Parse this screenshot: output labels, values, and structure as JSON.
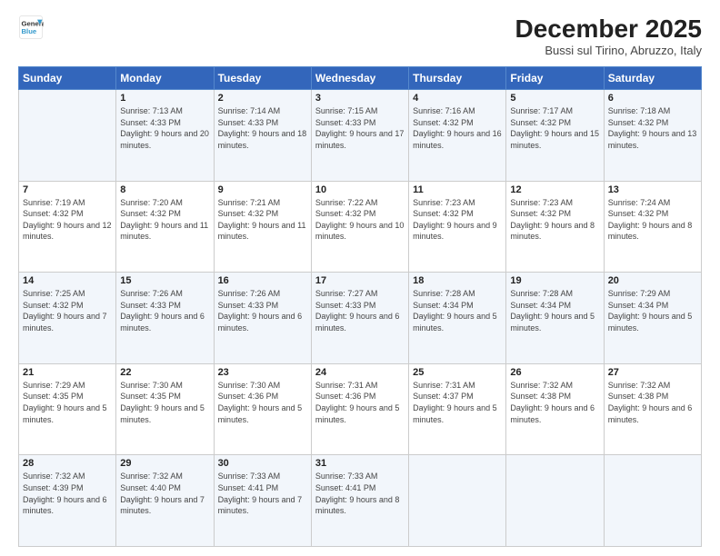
{
  "logo": {
    "line1": "General",
    "line2": "Blue"
  },
  "header": {
    "month": "December 2025",
    "location": "Bussi sul Tirino, Abruzzo, Italy"
  },
  "days_of_week": [
    "Sunday",
    "Monday",
    "Tuesday",
    "Wednesday",
    "Thursday",
    "Friday",
    "Saturday"
  ],
  "weeks": [
    [
      {
        "day": "",
        "sunrise": "",
        "sunset": "",
        "daylight": "",
        "empty": true
      },
      {
        "day": "1",
        "sunrise": "7:13 AM",
        "sunset": "4:33 PM",
        "daylight": "9 hours and 20 minutes."
      },
      {
        "day": "2",
        "sunrise": "7:14 AM",
        "sunset": "4:33 PM",
        "daylight": "9 hours and 18 minutes."
      },
      {
        "day": "3",
        "sunrise": "7:15 AM",
        "sunset": "4:33 PM",
        "daylight": "9 hours and 17 minutes."
      },
      {
        "day": "4",
        "sunrise": "7:16 AM",
        "sunset": "4:32 PM",
        "daylight": "9 hours and 16 minutes."
      },
      {
        "day": "5",
        "sunrise": "7:17 AM",
        "sunset": "4:32 PM",
        "daylight": "9 hours and 15 minutes."
      },
      {
        "day": "6",
        "sunrise": "7:18 AM",
        "sunset": "4:32 PM",
        "daylight": "9 hours and 13 minutes."
      }
    ],
    [
      {
        "day": "7",
        "sunrise": "7:19 AM",
        "sunset": "4:32 PM",
        "daylight": "9 hours and 12 minutes."
      },
      {
        "day": "8",
        "sunrise": "7:20 AM",
        "sunset": "4:32 PM",
        "daylight": "9 hours and 11 minutes."
      },
      {
        "day": "9",
        "sunrise": "7:21 AM",
        "sunset": "4:32 PM",
        "daylight": "9 hours and 11 minutes."
      },
      {
        "day": "10",
        "sunrise": "7:22 AM",
        "sunset": "4:32 PM",
        "daylight": "9 hours and 10 minutes."
      },
      {
        "day": "11",
        "sunrise": "7:23 AM",
        "sunset": "4:32 PM",
        "daylight": "9 hours and 9 minutes."
      },
      {
        "day": "12",
        "sunrise": "7:23 AM",
        "sunset": "4:32 PM",
        "daylight": "9 hours and 8 minutes."
      },
      {
        "day": "13",
        "sunrise": "7:24 AM",
        "sunset": "4:32 PM",
        "daylight": "9 hours and 8 minutes."
      }
    ],
    [
      {
        "day": "14",
        "sunrise": "7:25 AM",
        "sunset": "4:32 PM",
        "daylight": "9 hours and 7 minutes."
      },
      {
        "day": "15",
        "sunrise": "7:26 AM",
        "sunset": "4:33 PM",
        "daylight": "9 hours and 6 minutes."
      },
      {
        "day": "16",
        "sunrise": "7:26 AM",
        "sunset": "4:33 PM",
        "daylight": "9 hours and 6 minutes."
      },
      {
        "day": "17",
        "sunrise": "7:27 AM",
        "sunset": "4:33 PM",
        "daylight": "9 hours and 6 minutes."
      },
      {
        "day": "18",
        "sunrise": "7:28 AM",
        "sunset": "4:34 PM",
        "daylight": "9 hours and 5 minutes."
      },
      {
        "day": "19",
        "sunrise": "7:28 AM",
        "sunset": "4:34 PM",
        "daylight": "9 hours and 5 minutes."
      },
      {
        "day": "20",
        "sunrise": "7:29 AM",
        "sunset": "4:34 PM",
        "daylight": "9 hours and 5 minutes."
      }
    ],
    [
      {
        "day": "21",
        "sunrise": "7:29 AM",
        "sunset": "4:35 PM",
        "daylight": "9 hours and 5 minutes."
      },
      {
        "day": "22",
        "sunrise": "7:30 AM",
        "sunset": "4:35 PM",
        "daylight": "9 hours and 5 minutes."
      },
      {
        "day": "23",
        "sunrise": "7:30 AM",
        "sunset": "4:36 PM",
        "daylight": "9 hours and 5 minutes."
      },
      {
        "day": "24",
        "sunrise": "7:31 AM",
        "sunset": "4:36 PM",
        "daylight": "9 hours and 5 minutes."
      },
      {
        "day": "25",
        "sunrise": "7:31 AM",
        "sunset": "4:37 PM",
        "daylight": "9 hours and 5 minutes."
      },
      {
        "day": "26",
        "sunrise": "7:32 AM",
        "sunset": "4:38 PM",
        "daylight": "9 hours and 6 minutes."
      },
      {
        "day": "27",
        "sunrise": "7:32 AM",
        "sunset": "4:38 PM",
        "daylight": "9 hours and 6 minutes."
      }
    ],
    [
      {
        "day": "28",
        "sunrise": "7:32 AM",
        "sunset": "4:39 PM",
        "daylight": "9 hours and 6 minutes."
      },
      {
        "day": "29",
        "sunrise": "7:32 AM",
        "sunset": "4:40 PM",
        "daylight": "9 hours and 7 minutes."
      },
      {
        "day": "30",
        "sunrise": "7:33 AM",
        "sunset": "4:41 PM",
        "daylight": "9 hours and 7 minutes."
      },
      {
        "day": "31",
        "sunrise": "7:33 AM",
        "sunset": "4:41 PM",
        "daylight": "9 hours and 8 minutes."
      },
      {
        "day": "",
        "sunrise": "",
        "sunset": "",
        "daylight": "",
        "empty": true
      },
      {
        "day": "",
        "sunrise": "",
        "sunset": "",
        "daylight": "",
        "empty": true
      },
      {
        "day": "",
        "sunrise": "",
        "sunset": "",
        "daylight": "",
        "empty": true
      }
    ]
  ],
  "labels": {
    "sunrise_prefix": "Sunrise: ",
    "sunset_prefix": "Sunset: ",
    "daylight_prefix": "Daylight: "
  }
}
